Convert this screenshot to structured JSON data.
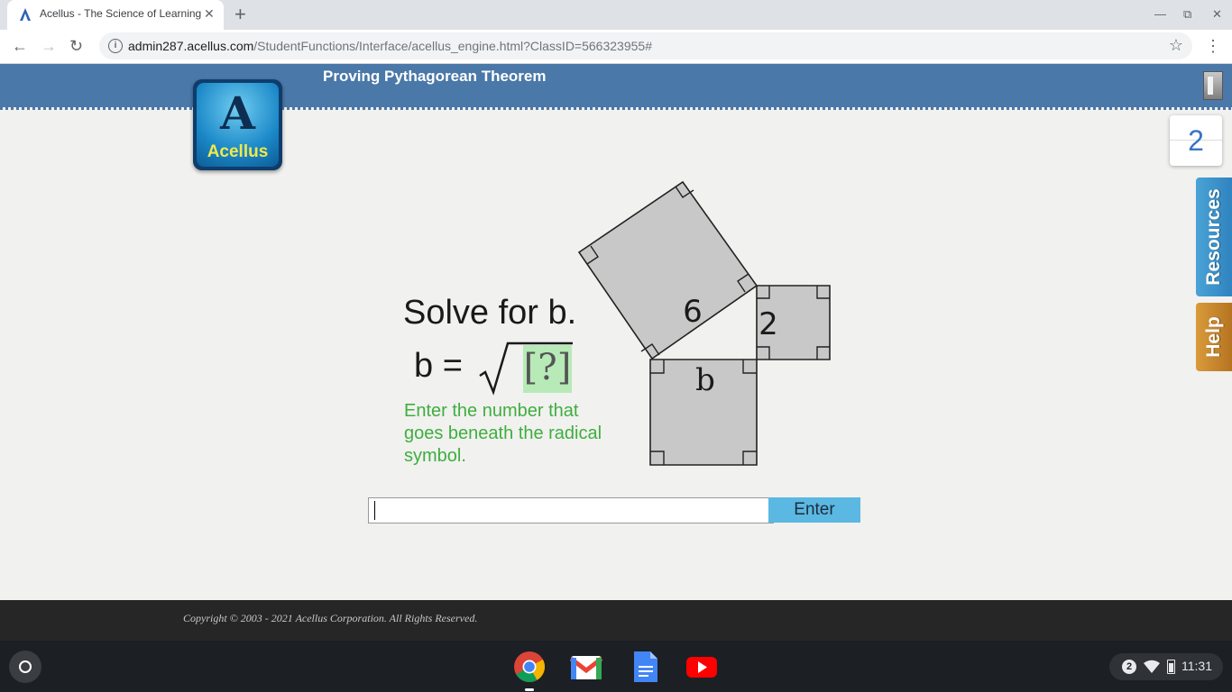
{
  "browser": {
    "tab_title": "Acellus - The Science of Learning",
    "url_host": "admin287.acellus.com",
    "url_path": "/StudentFunctions/Interface/acellus_engine.html?ClassID=566323955#"
  },
  "app": {
    "lesson_title": "Proving Pythagorean Theorem",
    "logo_text": "Acellus",
    "side_counter": "2",
    "resources_label": "Resources",
    "help_label": "Help"
  },
  "question": {
    "title": "Solve for b.",
    "equation_lhs": "b =",
    "placeholder_box": "[?]",
    "hint": "Enter the number that goes beneath the radical symbol.",
    "diagram": {
      "hypotenuse_label": "6",
      "leg_a_label": "2",
      "leg_b_label": "b"
    }
  },
  "answer": {
    "value": "",
    "enter_label": "Enter"
  },
  "footer": {
    "copyright": "Copyright © 2003 - 2021 Acellus Corporation.  All Rights Reserved."
  },
  "shelf": {
    "notification_count": "2",
    "time": "11:31"
  },
  "icons": [
    "acellus-favicon",
    "close-icon",
    "plus-icon",
    "minimize-icon",
    "maximize-icon",
    "window-close-icon",
    "back-icon",
    "forward-icon",
    "reload-icon",
    "info-icon",
    "star-icon",
    "menu-icon",
    "exit-door-icon",
    "chrome-icon",
    "gmail-icon",
    "docs-icon",
    "youtube-icon",
    "wifi-icon",
    "battery-icon"
  ]
}
